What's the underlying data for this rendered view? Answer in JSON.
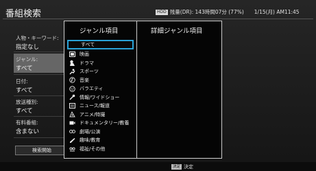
{
  "header": {
    "title": "番組検索",
    "hdd_badge": "HDD",
    "remaining": "残量(DR): 143時間07分 (77%)",
    "datetime": "1/15(月) AM11:45"
  },
  "left_panel": {
    "fields": [
      {
        "label": "人物・キーワード:",
        "value": "指定なし"
      },
      {
        "label": "ジャンル:",
        "value": "すべて"
      },
      {
        "label": "日付:",
        "value": "すべて"
      },
      {
        "label": "放送種別:",
        "value": "すべて"
      },
      {
        "label": "有料番組:",
        "value": "含まない"
      }
    ],
    "search_button": "検索開始"
  },
  "dialog": {
    "genre_title": "ジャンル項目",
    "detail_title": "詳細ジャンル項目",
    "items": [
      {
        "label": "すべて",
        "icon": "none"
      },
      {
        "label": "映画",
        "icon": "film-icon"
      },
      {
        "label": "ドラマ",
        "icon": "drama-icon"
      },
      {
        "label": "スポーツ",
        "icon": "sports-icon"
      },
      {
        "label": "音楽",
        "icon": "music-icon"
      },
      {
        "label": "バラエティ",
        "icon": "variety-icon"
      },
      {
        "label": "情報/ワイドショー",
        "icon": "microphone-icon"
      },
      {
        "label": "ニュース/報道",
        "icon": "news-icon"
      },
      {
        "label": "アニメ/特撮",
        "icon": "anime-icon"
      },
      {
        "label": "ドキュメンタリー/教養",
        "icon": "documentary-icon"
      },
      {
        "label": "劇場/公演",
        "icon": "theater-icon"
      },
      {
        "label": "趣味/教育",
        "icon": "pencil-icon"
      },
      {
        "label": "福祉/その他",
        "icon": "welfare-icon"
      }
    ],
    "selected_index": 0
  },
  "footer": {
    "key_badge": "決定",
    "key_label": "決定"
  },
  "colors": {
    "selection_border": "#2aa3d8",
    "dialog_background": "#050505",
    "highlight_row": "#666666"
  }
}
